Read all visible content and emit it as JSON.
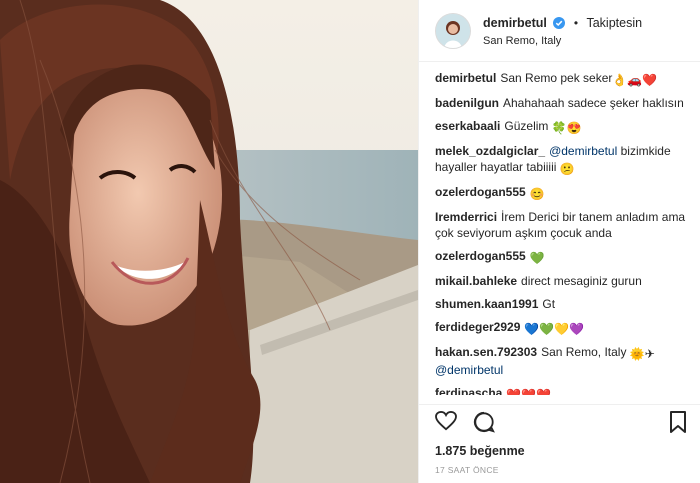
{
  "post": {
    "username": "demirbetul",
    "follow_status": "Takiptesin",
    "location": "San Remo, Italy",
    "likes": "1.875 beğenme",
    "time": "17 SAAT ÖNCE"
  },
  "comments": [
    {
      "user": "demirbetul",
      "text": "San Remo pek seker"
    },
    {
      "user": "badenilgun",
      "text": "Ahahahaah sadece şeker haklısın"
    },
    {
      "user": "eserkabaali",
      "text": "Güzelim"
    },
    {
      "user": "melek_ozdalgiclar_",
      "mention": "@demirbetul",
      "text": "bizimkide hayaller hayatlar tabiiiii"
    },
    {
      "user": "ozelerdogan555",
      "text": ""
    },
    {
      "user": "Iremderrici",
      "text": "İrem Derici bir tanem anladım ama çok seviyorum aşkım çocuk anda"
    },
    {
      "user": "ozelerdogan555",
      "text": ""
    },
    {
      "user": "mikail.bahleke",
      "text": "direct mesaginiz gurun"
    },
    {
      "user": "shumen.kaan1991",
      "text": "Gt"
    },
    {
      "user": "ferdideger2929",
      "text": ""
    },
    {
      "user": "hakan.sen.792303",
      "text": "San Remo, Italy",
      "mention2": "@demirbetul"
    },
    {
      "user": "ferdipascha",
      "text": ""
    }
  ],
  "colors": {
    "verified": "#3897f0",
    "heart_red": "#e0245e",
    "mention": "#003569"
  },
  "icons": [
    "verified-icon",
    "heart-icon",
    "comment-icon",
    "bookmark-icon"
  ]
}
